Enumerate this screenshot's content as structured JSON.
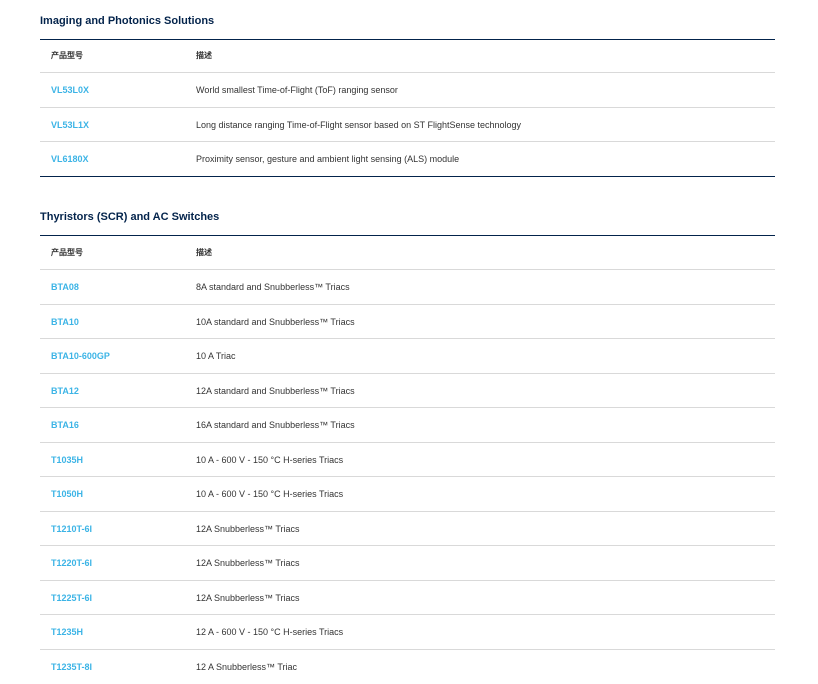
{
  "sections": [
    {
      "title": "Imaging and Photonics Solutions",
      "header": {
        "part": "产品型号",
        "desc": "描述"
      },
      "rows": [
        {
          "part": "VL53L0X",
          "desc": "World smallest Time-of-Flight (ToF) ranging sensor"
        },
        {
          "part": "VL53L1X",
          "desc": "Long distance ranging Time-of-Flight sensor based on ST FlightSense technology"
        },
        {
          "part": "VL6180X",
          "desc": "Proximity sensor, gesture and ambient light sensing (ALS) module"
        }
      ]
    },
    {
      "title": "Thyristors (SCR) and AC Switches",
      "header": {
        "part": "产品型号",
        "desc": "描述"
      },
      "rows": [
        {
          "part": "BTA08",
          "desc": "8A standard and Snubberless™ Triacs"
        },
        {
          "part": "BTA10",
          "desc": "10A standard and Snubberless™ Triacs"
        },
        {
          "part": "BTA10-600GP",
          "desc": "10 A Triac"
        },
        {
          "part": "BTA12",
          "desc": "12A standard and Snubberless™ Triacs"
        },
        {
          "part": "BTA16",
          "desc": "16A standard and Snubberless™ Triacs"
        },
        {
          "part": "T1035H",
          "desc": "10 A - 600 V - 150 °C H-series Triacs"
        },
        {
          "part": "T1050H",
          "desc": "10 A - 600 V - 150 °C H-series Triacs"
        },
        {
          "part": "T1210T-6I",
          "desc": "12A Snubberless™ Triacs"
        },
        {
          "part": "T1220T-6I",
          "desc": "12A Snubberless™ Triacs"
        },
        {
          "part": "T1225T-6I",
          "desc": "12A Snubberless™ Triacs"
        },
        {
          "part": "T1235H",
          "desc": "12 A - 600 V - 150 °C H-series Triacs"
        },
        {
          "part": "T1235T-8I",
          "desc": "12 A Snubberless™ Triac"
        }
      ]
    }
  ],
  "colors": {
    "heading": "#03234b",
    "link": "#3cb4e6",
    "rule": "#d9d9d9"
  }
}
